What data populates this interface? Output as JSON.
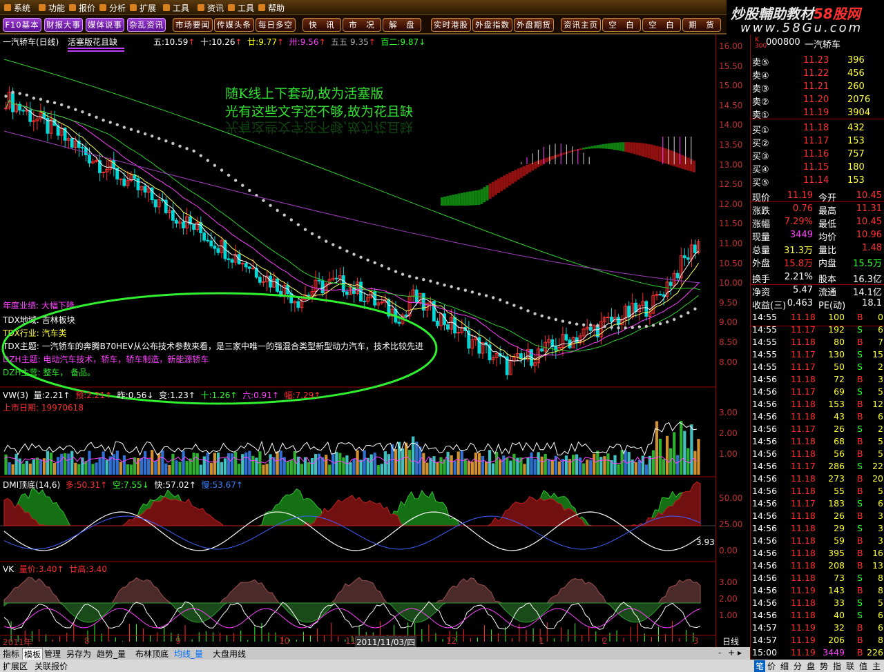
{
  "menu": [
    "系统",
    "功能",
    "报价",
    "分析",
    "扩展",
    "工具",
    "资讯",
    "工具",
    "帮助"
  ],
  "toolbar": [
    "F10基本",
    "财报大事",
    "媒体说事",
    "杂乱资讯",
    "市场要闻",
    "传媒头条",
    "每日多空",
    "快　讯",
    "市　况",
    "解　盘",
    "实时港股",
    "外盘指数",
    "外盘期货",
    "资讯主页",
    "空　白",
    "空　白",
    "期　货"
  ],
  "logo": {
    "line1a": "炒股輔助教材",
    "line1b": "58股网",
    "line2": "www.58Gu.com"
  },
  "chart_header": {
    "name": "一汽轿车(日线)",
    "template": "活塞版花且缺",
    "ma": [
      {
        "label": "五:",
        "value": "10.59"
      },
      {
        "label": "十:",
        "value": "10.26"
      },
      {
        "label": "廿:",
        "value": "9.77"
      },
      {
        "label": "卅:",
        "value": "9.56"
      },
      {
        "label": "五五",
        "value": "9.35"
      },
      {
        "label": "百二:",
        "value": "9.87"
      }
    ]
  },
  "annotation": {
    "line1": "随K线上下套动,故为活塞版",
    "line2": "光有这些文字还不够,故为花且缺"
  },
  "info": [
    {
      "label": "年度业绩:",
      "value": "大幅下降"
    },
    {
      "label": "TDX地域:",
      "value": "吉林板块"
    },
    {
      "label": "TDX行业:",
      "value": "汽车类"
    },
    {
      "label": "TDX主题:",
      "value": "一汽轿车的奔腾B70HEV从公布技术参数来看，是三家中唯一的强混合类型新型动力汽车，技术比较先进"
    },
    {
      "label": "DZH主题:",
      "value": "电动汽车技术，轿车，轿车制造，新能源轿车"
    },
    {
      "label": "DZH主营:",
      "value": "整车，  备品。"
    }
  ],
  "vw": {
    "title": "VW(3)",
    "items": [
      "量:2.21↑",
      "预:2.21↑",
      "昨:0.56↓",
      "变:1.23↑",
      "十:1.26↑",
      "六:0.91↑",
      "幅:7.29↑"
    ],
    "list_date_label": "上市日期:",
    "list_date": "19970618"
  },
  "dmi": {
    "title": "DMI顶底(14,6)",
    "items": [
      "多:50.31↑",
      "空:7.55↓",
      "快:57.02↑",
      "慢:53.67↑"
    ],
    "side": "3.93"
  },
  "vk": {
    "title": "VK",
    "items": [
      "量价:3.40↑",
      "廿高:3.40"
    ]
  },
  "price_axis": [
    "16.00",
    "15.50",
    "15.00",
    "14.50",
    "14.00",
    "13.50",
    "13.00",
    "12.50",
    "12.00",
    "11.50",
    "11.00",
    "10.50",
    "10.00",
    "9.50",
    "9.00",
    "8.50",
    "8.00"
  ],
  "vol_axis": [
    "3.00",
    "2.00",
    "1.00"
  ],
  "dmi_axis": [
    "50.00",
    "25.00",
    "0.00"
  ],
  "vk_axis": [
    "3.00",
    "2.00",
    "1.00"
  ],
  "date_axis": [
    "2011年",
    "8",
    "9",
    "10",
    "11",
    "2011/11/03/四",
    "12",
    "1",
    "2",
    "3"
  ],
  "day_label": "日线",
  "quote": {
    "code": "000800",
    "name": "一汽轿车",
    "asks": [
      [
        "卖⑤",
        "11.23",
        "396"
      ],
      [
        "卖④",
        "11.22",
        "456"
      ],
      [
        "卖③",
        "11.21",
        "260"
      ],
      [
        "卖②",
        "11.20",
        "2076"
      ],
      [
        "卖①",
        "11.19",
        "3904"
      ]
    ],
    "bids": [
      [
        "买①",
        "11.18",
        "432"
      ],
      [
        "买②",
        "11.17",
        "153"
      ],
      [
        "买③",
        "11.16",
        "757"
      ],
      [
        "买④",
        "11.15",
        "180"
      ],
      [
        "买⑤",
        "11.14",
        "153"
      ]
    ],
    "stats": [
      [
        "现价",
        "11.19",
        "今开",
        "10.45"
      ],
      [
        "涨跌",
        "0.76",
        "最高",
        "11.31"
      ],
      [
        "涨幅",
        "7.29%",
        "最低",
        "10.45"
      ],
      [
        "现量",
        "3449",
        "均价",
        "10.96"
      ],
      [
        "总量",
        "31.3万",
        "量比",
        "1.48"
      ],
      [
        "外盘",
        "15.8万",
        "内盘",
        "15.5万"
      ],
      [
        "换手",
        "2.21%",
        "股本",
        "16.3亿"
      ],
      [
        "净资",
        "5.47",
        "流通",
        "14.1亿"
      ],
      [
        "收益(三)",
        "0.463",
        "PE(动)",
        "18.1"
      ]
    ],
    "ticks": [
      [
        "14:55",
        "11.18",
        "100",
        "B",
        "0"
      ],
      [
        "14:55",
        "11.17",
        "192",
        "S",
        "6"
      ],
      [
        "14:55",
        "11.18",
        "80",
        "B",
        "7"
      ],
      [
        "14:55",
        "11.17",
        "130",
        "S",
        "15"
      ],
      [
        "14:55",
        "11.17",
        "50",
        "S",
        "2"
      ],
      [
        "14:56",
        "11.18",
        "72",
        "B",
        "3"
      ],
      [
        "14:56",
        "11.17",
        "69",
        "S",
        "5"
      ],
      [
        "14:56",
        "11.18",
        "153",
        "B",
        "12"
      ],
      [
        "14:56",
        "11.18",
        "43",
        "B",
        "6"
      ],
      [
        "14:56",
        "11.17",
        "26",
        "S",
        "2"
      ],
      [
        "14:56",
        "11.18",
        "68",
        "B",
        "5"
      ],
      [
        "14:56",
        "11.18",
        "56",
        "B",
        "5"
      ],
      [
        "14:56",
        "11.17",
        "286",
        "S",
        "22"
      ],
      [
        "14:56",
        "11.18",
        "273",
        "B",
        "20"
      ],
      [
        "14:56",
        "11.18",
        "55",
        "B",
        "5"
      ],
      [
        "14:56",
        "11.17",
        "183",
        "S",
        "6"
      ],
      [
        "14:56",
        "11.18",
        "26",
        "B",
        "3"
      ],
      [
        "14:56",
        "11.18",
        "29",
        "S",
        "3"
      ],
      [
        "14:56",
        "11.18",
        "59",
        "B",
        "3"
      ],
      [
        "14:56",
        "11.18",
        "395",
        "B",
        "16"
      ],
      [
        "14:56",
        "11.18",
        "208",
        "B",
        "13"
      ],
      [
        "14:56",
        "11.18",
        "73",
        "S",
        "8"
      ],
      [
        "14:56",
        "11.19",
        "143",
        "B",
        "8"
      ],
      [
        "14:56",
        "11.18",
        "33",
        "S",
        "5"
      ],
      [
        "14:56",
        "11.18",
        "40",
        "S",
        "6"
      ],
      [
        "14:57",
        "11.19",
        "32",
        "B",
        "6"
      ],
      [
        "14:57",
        "11.19",
        "206",
        "B",
        "8"
      ],
      [
        "15:00",
        "11.19",
        "3449",
        "B",
        "226"
      ]
    ]
  },
  "bottom_tabs": [
    "指标",
    "模板",
    "管理",
    "另存为",
    "趋势_量",
    "布林顶底",
    "均线_量",
    "大盘用线"
  ],
  "status": [
    "扩展区",
    "关联报价"
  ],
  "status_right": [
    "笔",
    "价",
    "细",
    "分",
    "盘",
    "势",
    "指",
    "联",
    "值",
    "主"
  ],
  "colors": {
    "up": "#ff3030",
    "down": "#00ffff",
    "green_ma": "#30c030",
    "frame": "#a00000"
  }
}
